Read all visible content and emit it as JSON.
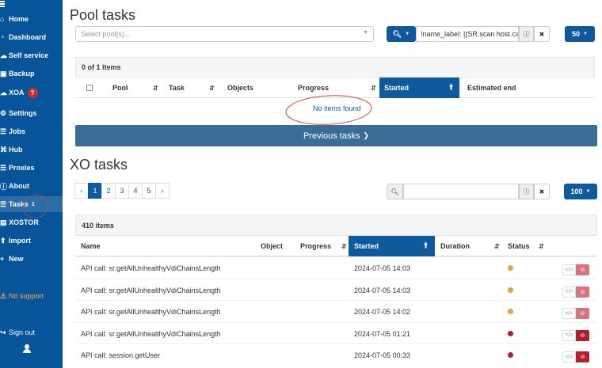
{
  "sidebar": {
    "items": [
      {
        "icon": "home-icon",
        "glyph": "⌂",
        "label": "Home"
      },
      {
        "icon": "dashboard-icon",
        "glyph": "◔",
        "label": "Dashboard"
      },
      {
        "icon": "self-service-icon",
        "glyph": "☁",
        "label": "Self service"
      },
      {
        "icon": "backup-icon",
        "glyph": "▣",
        "label": "Backup"
      },
      {
        "icon": "xoa-icon",
        "glyph": "☁",
        "label": "XOA",
        "badge": "?"
      },
      {
        "icon": "settings-icon",
        "glyph": "⚙",
        "label": "Settings"
      },
      {
        "icon": "jobs-icon",
        "glyph": "☰",
        "label": "Jobs"
      },
      {
        "icon": "hub-icon",
        "glyph": "⌘",
        "label": "Hub"
      },
      {
        "icon": "proxies-icon",
        "glyph": "☰",
        "label": "Proxies"
      },
      {
        "icon": "about-icon",
        "glyph": "ⓘ",
        "label": "About"
      },
      {
        "icon": "tasks-icon",
        "glyph": "☰",
        "label": "Tasks",
        "count": "1"
      },
      {
        "icon": "xostor-icon",
        "glyph": "▤",
        "label": "XOSTOR"
      },
      {
        "icon": "import-icon",
        "glyph": "⬆",
        "label": "Import"
      },
      {
        "icon": "new-icon",
        "glyph": "+",
        "label": "New"
      }
    ],
    "no_support": "No support",
    "sign_out": "Sign out",
    "warn_glyph": "⚠",
    "signout_glyph": "↪",
    "user_glyph": "●"
  },
  "pool_tasks": {
    "title": "Pool tasks",
    "pool_placeholder": "Select pool(s)...",
    "filter_value": "!name_label: |(SR.scan host.ca",
    "page_size": "50",
    "count_label": "0 of 1 items",
    "columns": [
      "Pool",
      "Task",
      "Objects",
      "Progress",
      "Started",
      "Estimated end"
    ],
    "empty_text": "No items found",
    "previous_tasks": "Previous tasks"
  },
  "xo_tasks": {
    "title": "XO tasks",
    "pages": [
      "‹",
      "1",
      "2",
      "3",
      "4",
      "5",
      "›"
    ],
    "page_size": "100",
    "count_label": "410 items",
    "columns": [
      "Name",
      "Object",
      "Progress",
      "Started",
      "Duration",
      "Status"
    ],
    "rows": [
      {
        "name": "API call: sr.getAllUnhealthyVdiChainsLength",
        "started": "2024-07-05 14:03",
        "status_color": "#e8a33d"
      },
      {
        "name": "API call: sr.getAllUnhealthyVdiChainsLength",
        "started": "2024-07-05 14:03",
        "status_color": "#e8a33d"
      },
      {
        "name": "API call: sr.getAllUnhealthyVdiChainsLength",
        "started": "2024-07-05 14:02",
        "status_color": "#e8a33d"
      },
      {
        "name": "API call: sr.getAllUnhealthyVdiChainsLength",
        "started": "2024-07-05 01:21",
        "status_color": "#b0202a"
      },
      {
        "name": "API call: session.getUser",
        "started": "2024-07-05 00:33",
        "status_color": "#b0202a"
      }
    ]
  },
  "colors": {
    "accent": "#0e5a9c",
    "sidebar": "#08549a",
    "cancel_light": "#d9747e",
    "cancel_dark": "#b0202a"
  }
}
